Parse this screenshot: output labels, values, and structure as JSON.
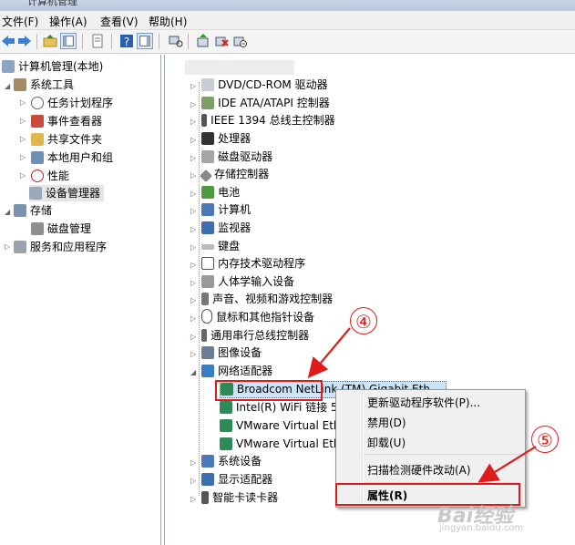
{
  "window": {
    "title": "计算机管理"
  },
  "menu": {
    "items": [
      "文件(F)",
      "操作(A)",
      "查看(V)",
      "帮助(H)"
    ]
  },
  "tree": {
    "root": "计算机管理(本地)",
    "items": [
      "系统工具",
      "任务计划程序",
      "事件查看器",
      "共享文件夹",
      "本地用户和组",
      "性能",
      "设备管理器",
      "存储",
      "磁盘管理",
      "服务和应用程序"
    ]
  },
  "devices": {
    "items": [
      "DVD/CD-ROM 驱动器",
      "IDE ATA/ATAPI 控制器",
      "IEEE 1394 总线主控制器",
      "处理器",
      "磁盘驱动器",
      "存储控制器",
      "电池",
      "计算机",
      "监视器",
      "键盘",
      "内存技术驱动程序",
      "人体学输入设备",
      "声音、视频和游戏控制器",
      "鼠标和其他指针设备",
      "通用串行总线控制器",
      "图像设备",
      "网络适配器"
    ],
    "adapters": [
      "Broadcom NetLink (TM) Gigabit Eth...",
      "Intel(R) WiFi 链接 5",
      "VMware Virtual Eth",
      "VMware Virtual Eth"
    ],
    "after": [
      "系统设备",
      "显示适配器",
      "智能卡读卡器"
    ]
  },
  "context_menu": {
    "update": "更新驱动程序软件(P)...",
    "disable": "禁用(D)",
    "uninstall": "卸载(U)",
    "scan": "扫描检测硬件改动(A)",
    "properties": "属性(R)"
  },
  "annotations": {
    "four": "④",
    "five": "⑤"
  },
  "watermark": {
    "text": "Bai经验",
    "sub": "jingyan.baidu.com"
  },
  "colors": {
    "annotation_red": "#e01b1b"
  }
}
